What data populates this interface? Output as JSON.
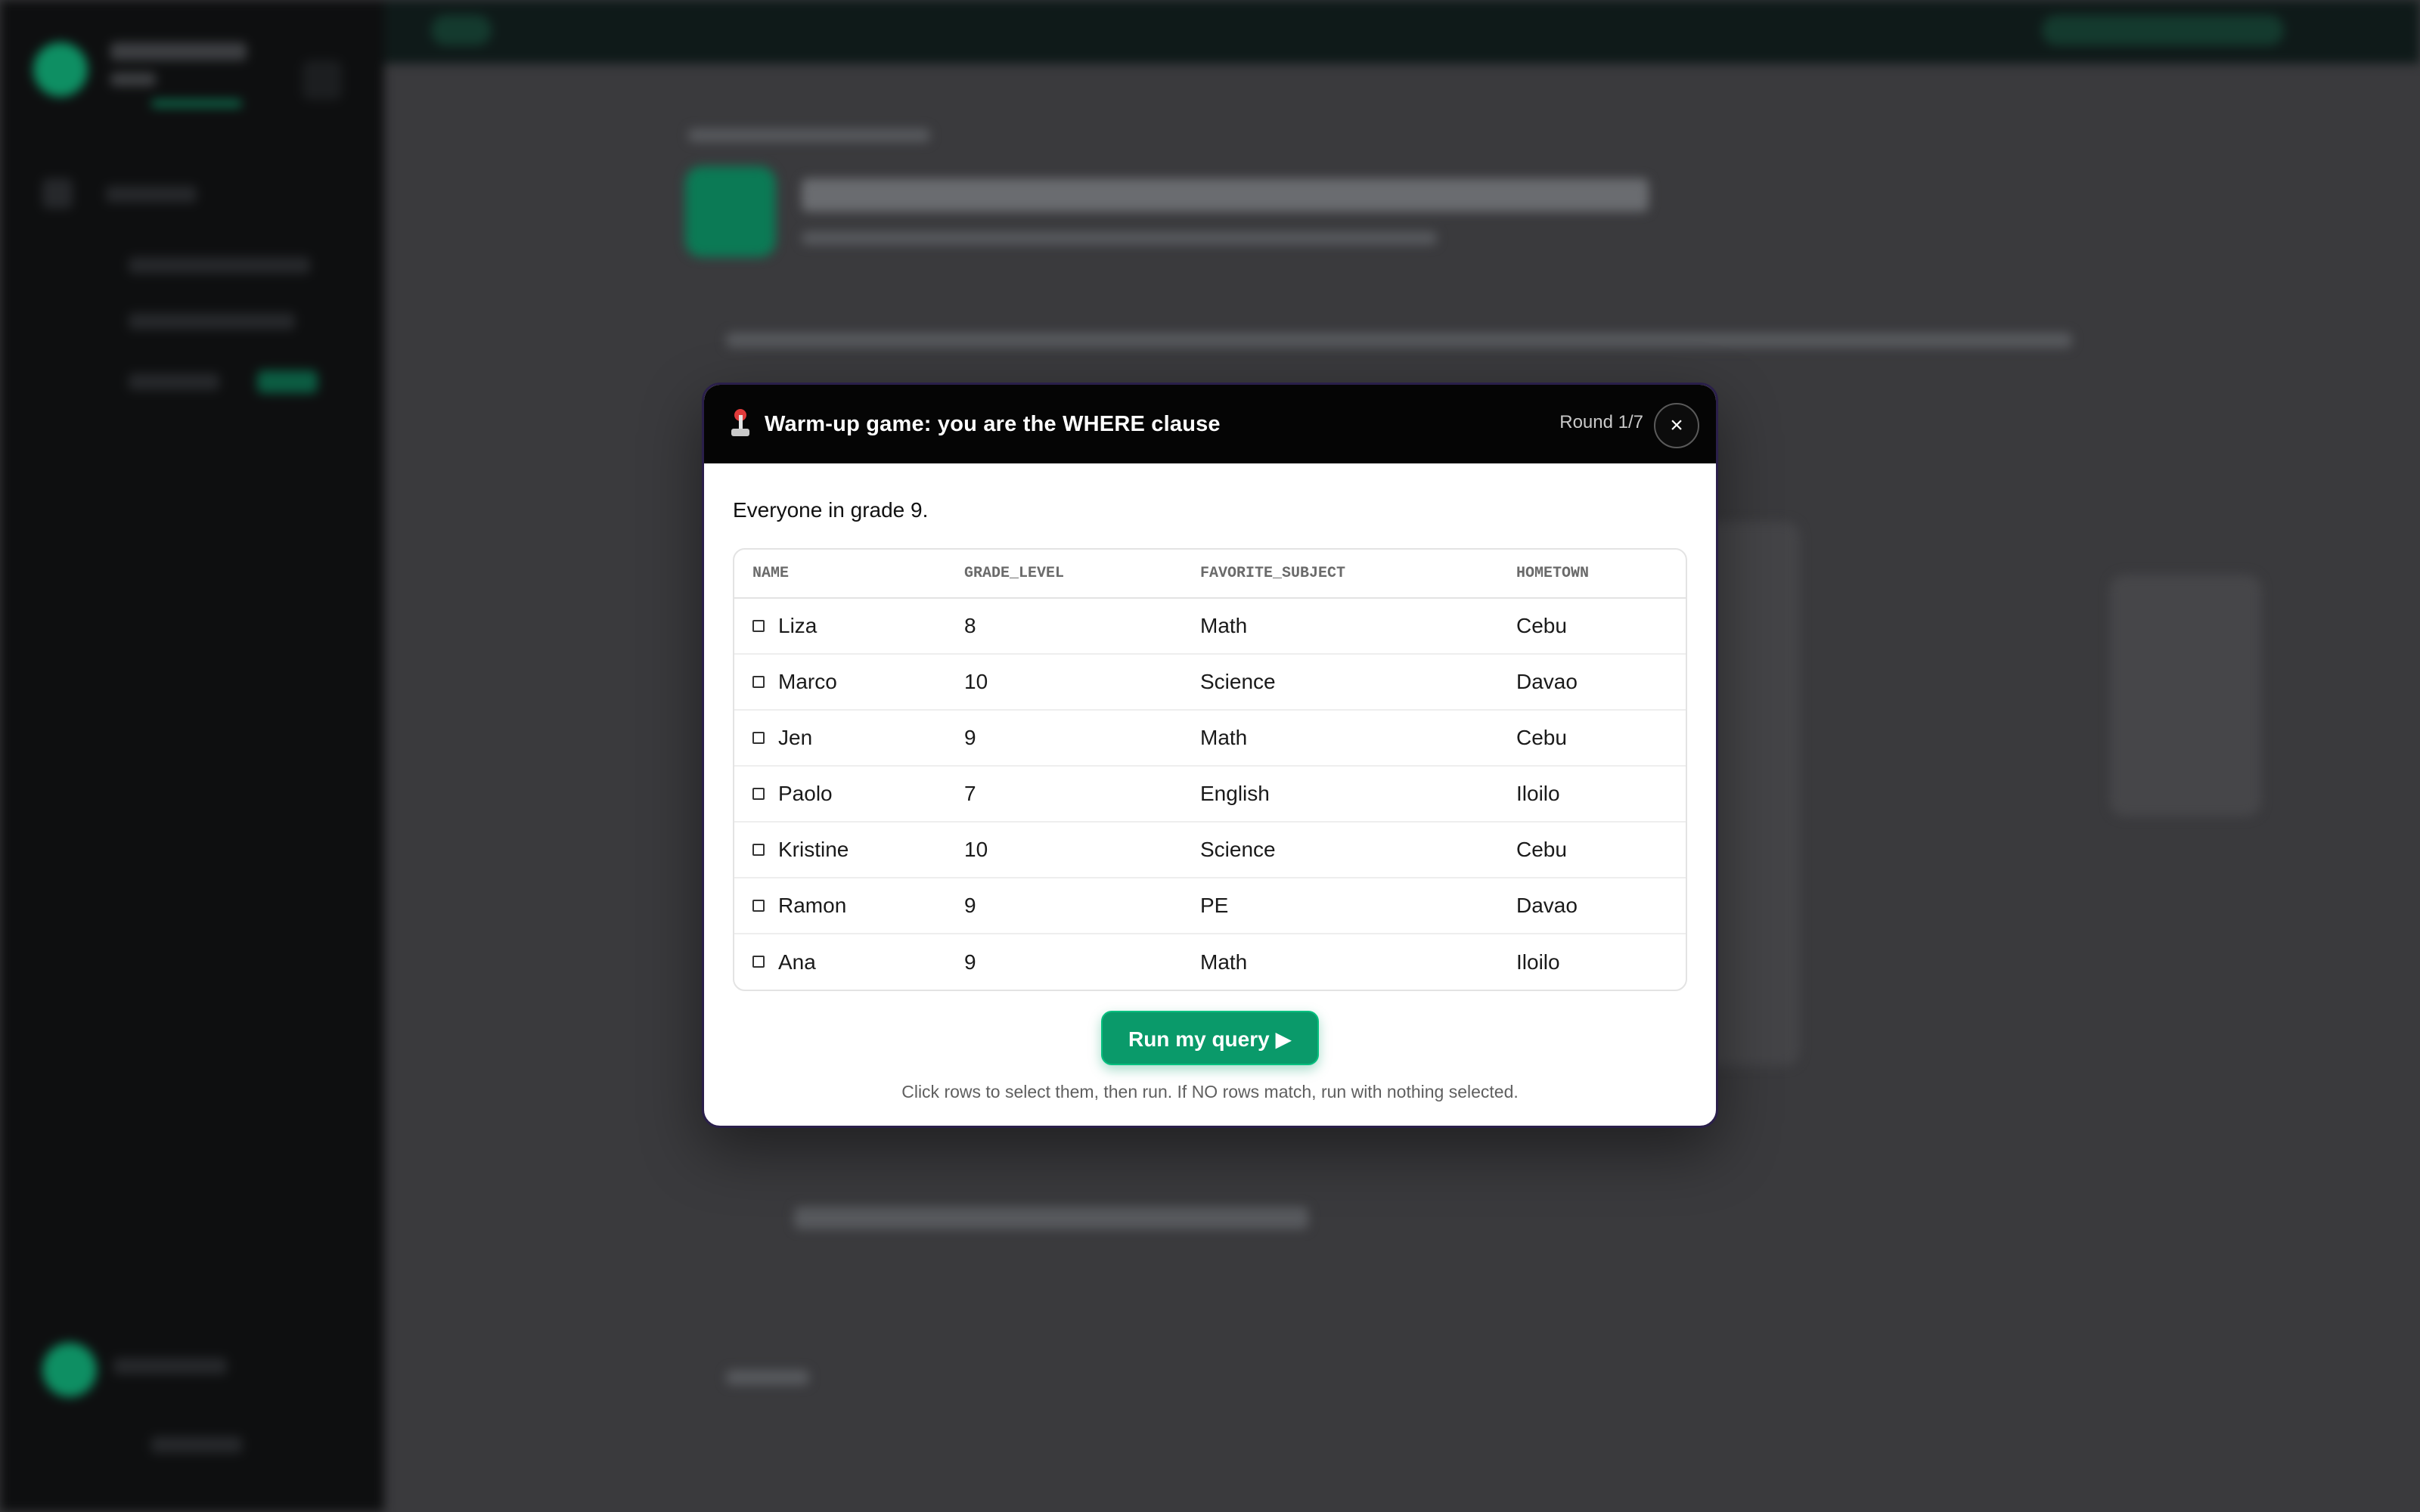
{
  "modal": {
    "title": "Warm-up game: you are the WHERE clause",
    "round": "Round 1/7",
    "close_icon": "×",
    "prompt": "Everyone in grade 9.",
    "table": {
      "columns": [
        "NAME",
        "GRADE_LEVEL",
        "FAVORITE_SUBJECT",
        "HOMETOWN"
      ],
      "rows": [
        {
          "name": "Liza",
          "grade_level": "8",
          "favorite_subject": "Math",
          "hometown": "Cebu"
        },
        {
          "name": "Marco",
          "grade_level": "10",
          "favorite_subject": "Science",
          "hometown": "Davao"
        },
        {
          "name": "Jen",
          "grade_level": "9",
          "favorite_subject": "Math",
          "hometown": "Cebu"
        },
        {
          "name": "Paolo",
          "grade_level": "7",
          "favorite_subject": "English",
          "hometown": "Iloilo"
        },
        {
          "name": "Kristine",
          "grade_level": "10",
          "favorite_subject": "Science",
          "hometown": "Cebu"
        },
        {
          "name": "Ramon",
          "grade_level": "9",
          "favorite_subject": "PE",
          "hometown": "Davao"
        },
        {
          "name": "Ana",
          "grade_level": "9",
          "favorite_subject": "Math",
          "hometown": "Iloilo"
        }
      ]
    },
    "run_button": "Run my query ▶",
    "hint": "Click rows to select them, then run. If NO rows match, run with nothing selected."
  },
  "colors": {
    "accent": "#0a9a6a",
    "header_bg": "#050505",
    "overlay_bg": "#3a3a3d"
  },
  "icons": {
    "header": "joystick-icon",
    "close": "close-icon",
    "row_checkbox": "checkbox-icon"
  }
}
